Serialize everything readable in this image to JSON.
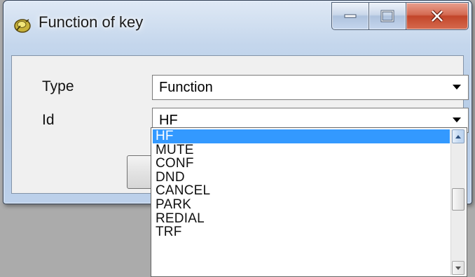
{
  "window": {
    "title": "Function of key",
    "icon": "key-app-icon",
    "buttons": [
      "minimize-icon",
      "maximize-icon",
      "close-icon"
    ]
  },
  "form": {
    "type_label": "Type",
    "type_value": "Function",
    "id_label": "Id",
    "id_value": "HF"
  },
  "ok_button": {
    "icon": "checkmark-icon",
    "color": "#2a9d1e"
  },
  "dropdown": {
    "options": [
      "HF",
      "MUTE",
      "CONF",
      "DND",
      "CANCEL",
      "PARK",
      "REDIAL",
      "TRF"
    ],
    "selected": "HF",
    "selection_color": "#3399ff"
  }
}
